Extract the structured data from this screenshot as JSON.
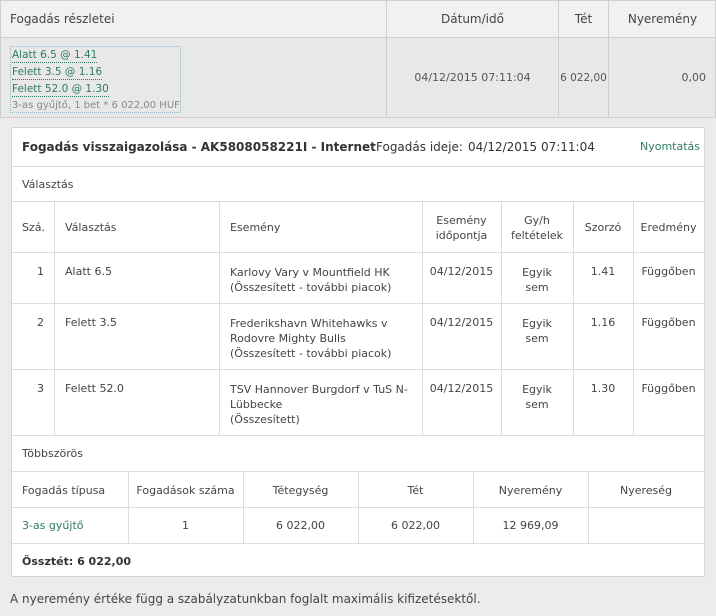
{
  "header": {
    "col_details": "Fogadás részletei",
    "col_datetime": "Dátum/idő",
    "col_stake": "Tét",
    "col_winnings": "Nyeremény"
  },
  "summary": {
    "selections": [
      "Alatt 6.5 @  1.41",
      "Felett 3.5 @  1.16",
      "Felett 52.0 @  1.30"
    ],
    "bet_info": "3-as gyűjtő, 1  bet * 6 022,00 HUF",
    "datetime": "04/12/2015 07:11:04",
    "stake": "6 022,00",
    "winnings": "0,00"
  },
  "confirmation": {
    "title_prefix": "Fogadás visszaigazolása",
    "bet_id": " - AK5808058221I",
    "channel": " - Internet",
    "time_label": "Fogadás ideje:",
    "time_value": "04/12/2015 07:11:04",
    "print_link": "Nyomtatás",
    "selections_label": "Választás",
    "table_headers": {
      "num": "Szá.",
      "selection": "Választás",
      "event": "Esemény",
      "event_time_1": "Esemény",
      "event_time_2": "időpontja",
      "cond_1": "Gy/h",
      "cond_2": "feltételek",
      "odds": "Szorzó",
      "result": "Eredmény"
    },
    "rows": [
      {
        "num": "1",
        "selection": "Alatt 6.5",
        "event_1": "Karlovy Vary v Mountfield HK",
        "event_2": "(Összesített - további piacok)",
        "event_3": "",
        "date": "04/12/2015",
        "cond_1": "Egyik",
        "cond_2": "sem",
        "odds": "1.41",
        "result": "Függőben"
      },
      {
        "num": "2",
        "selection": "Felett 3.5",
        "event_1": "Frederikshavn Whitehawks v",
        "event_2": "Rodovre Mighty Bulls",
        "event_3": "(Összesített - további piacok)",
        "date": "04/12/2015",
        "cond_1": "Egyik",
        "cond_2": "sem",
        "odds": "1.16",
        "result": "Függőben"
      },
      {
        "num": "3",
        "selection": "Felett 52.0",
        "event_1": "TSV Hannover Burgdorf v TuS N-",
        "event_2": "Lübbecke",
        "event_3": "(Összesített)",
        "date": "04/12/2015",
        "cond_1": "Egyik",
        "cond_2": "sem",
        "odds": "1.30",
        "result": "Függőben"
      }
    ],
    "multiples_label": "Többszörös",
    "multi_headers": {
      "type": "Fogadás típusa",
      "count": "Fogadások száma",
      "unit": "Tétegység",
      "stake": "Tét",
      "winnings": "Nyeremény",
      "profit": "Nyereség"
    },
    "multi_row": {
      "type": "3-as gyűjtő",
      "count": "1",
      "unit": "6 022,00",
      "stake": "6 022,00",
      "winnings": "12 969,09",
      "profit": ""
    },
    "total_label": "Össztét:",
    "total_value": "6 022,00"
  },
  "footnote": "A nyeremény értéke függ a szabályzatunkban foglalt maximális kifizetésektől."
}
